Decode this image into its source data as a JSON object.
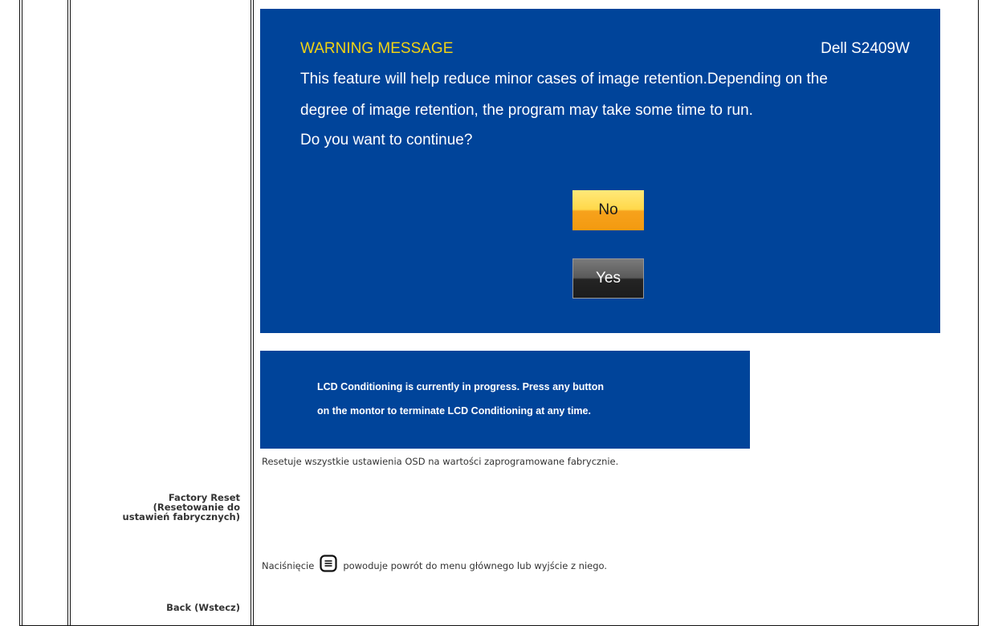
{
  "osd_warning": {
    "title": "WARNING MESSAGE",
    "model": "Dell S2409W",
    "line1": "This feature will help reduce minor cases of image retention.Depending on the",
    "line2": "degree of image retention, the program may take some time to run.",
    "line3": "Do you want to continue?",
    "no_button": "No",
    "yes_button": "Yes",
    "colors": {
      "background": "#00449a",
      "title": "#f2d313",
      "no_button": "#f7a21c",
      "yes_button": "#242424"
    }
  },
  "lcd_message": {
    "line1": "LCD Conditioning is currently in progress. Press any button",
    "line2": "on the montor to terminate LCD Conditioning at any time."
  },
  "factory_reset": {
    "description": "Resetuje wszystkie ustawienia OSD na wartości zaprogramowane fabrycznie.",
    "label_line1": "Factory Reset",
    "label_line2": "(Resetowanie do",
    "label_line3": "ustawień fabrycznych)"
  },
  "back": {
    "description_before": "Naciśnięcie",
    "icon": "menu-icon",
    "description_after": "powoduje powrót do menu głównego lub wyjście z niego.",
    "label": "Back (Wstecz)"
  }
}
